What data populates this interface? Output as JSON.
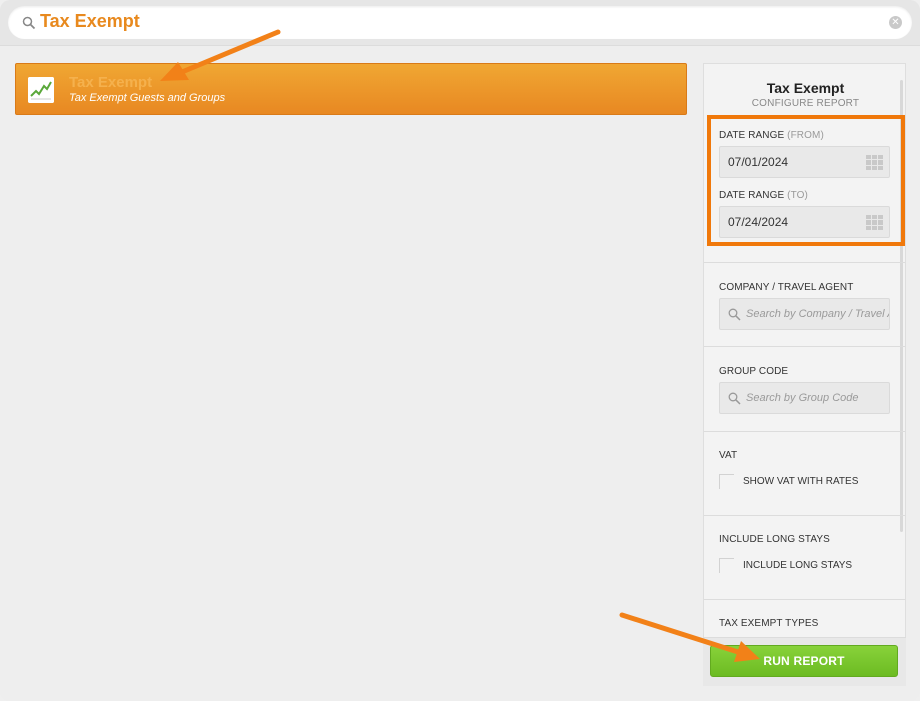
{
  "search": {
    "query": "Tax Exempt",
    "icon": "search-icon",
    "clear_icon": "clear-icon"
  },
  "report_list": [
    {
      "title": "Tax Exempt",
      "subtitle": "Tax Exempt Guests and Groups",
      "icon": "line-chart-icon"
    }
  ],
  "panel": {
    "title": "Tax Exempt",
    "subtitle": "CONFIGURE REPORT",
    "date_from": {
      "label": "DATE RANGE",
      "qualifier": "(FROM)",
      "value": "07/01/2024"
    },
    "date_to": {
      "label": "DATE RANGE",
      "qualifier": "(TO)",
      "value": "07/24/2024"
    },
    "company": {
      "label": "COMPANY / TRAVEL AGENT",
      "placeholder": "Search by Company / Travel Agent"
    },
    "group_code": {
      "label": "GROUP CODE",
      "placeholder": "Search by Group Code"
    },
    "vat": {
      "label": "VAT",
      "checkbox_label": "SHOW VAT WITH RATES",
      "checked": false
    },
    "long_stays": {
      "label": "INCLUDE LONG STAYS",
      "checkbox_label": "INCLUDE LONG STAYS",
      "checked": false
    },
    "tax_exempt_types": {
      "label": "TAX EXEMPT TYPES"
    },
    "run_button": "RUN REPORT"
  },
  "colors": {
    "accent_orange": "#e8891e",
    "highlight_orange": "#f0780a",
    "run_green": "#78c42c"
  }
}
